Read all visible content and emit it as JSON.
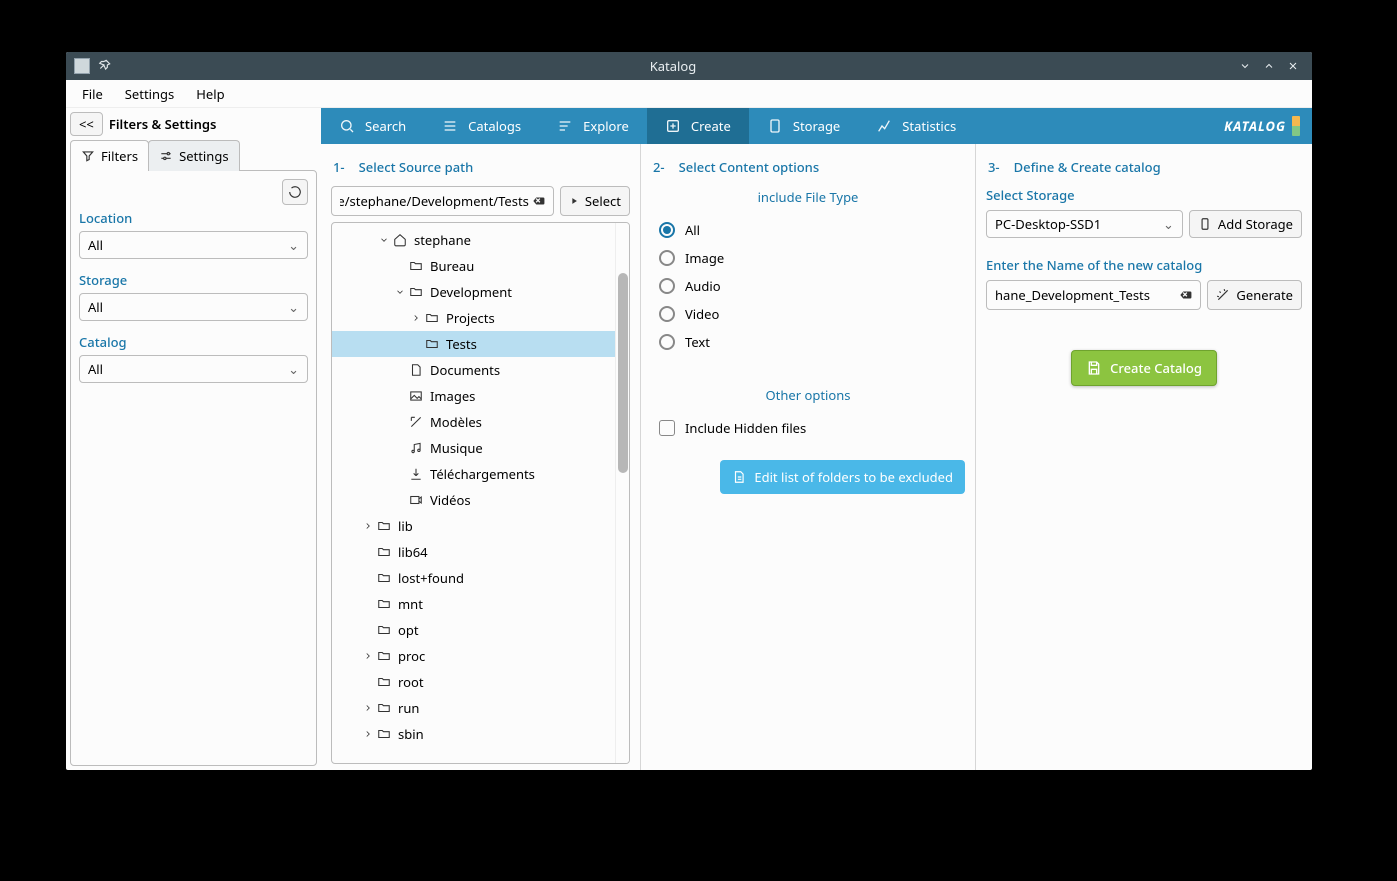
{
  "window": {
    "title": "Katalog"
  },
  "menu": {
    "file": "File",
    "settings": "Settings",
    "help": "Help"
  },
  "sidebar": {
    "collapse": "<<",
    "title": "Filters & Settings",
    "tabs": {
      "filters": "Filters",
      "settings": "Settings"
    },
    "location": {
      "label": "Location",
      "value": "All"
    },
    "storage": {
      "label": "Storage",
      "value": "All"
    },
    "catalog": {
      "label": "Catalog",
      "value": "All"
    }
  },
  "tabbar": {
    "search": "Search",
    "catalogs": "Catalogs",
    "explore": "Explore",
    "create": "Create",
    "storage": "Storage",
    "statistics": "Statistics",
    "brand": "KATALOG"
  },
  "step1": {
    "num": "1-",
    "title": "Select Source path",
    "path_value": "me/stephane/Development/Tests",
    "select_btn": "Select",
    "tree": {
      "stephane": "stephane",
      "bureau": "Bureau",
      "development": "Development",
      "projects": "Projects",
      "tests": "Tests",
      "documents": "Documents",
      "images": "Images",
      "modeles": "Modèles",
      "musique": "Musique",
      "telechargements": "Téléchargements",
      "videos": "Vidéos",
      "lib": "lib",
      "lib64": "lib64",
      "lostfound": "lost+found",
      "mnt": "mnt",
      "opt": "opt",
      "proc": "proc",
      "root": "root",
      "run": "run",
      "sbin": "sbin"
    }
  },
  "step2": {
    "num": "2-",
    "title": "Select Content options",
    "filetype_title": "include File Type",
    "options": {
      "all": "All",
      "image": "Image",
      "audio": "Audio",
      "video": "Video",
      "text": "Text"
    },
    "other_title": "Other options",
    "hidden_label": "Include Hidden files",
    "excluded_btn": "Edit list of folders to be excluded"
  },
  "step3": {
    "num": "3-",
    "title": "Define & Create catalog",
    "storage_label": "Select Storage",
    "storage_value": "PC-Desktop-SSD1",
    "add_storage_btn": "Add Storage",
    "name_label": "Enter the Name of the new catalog",
    "name_value": "hane_Development_Tests",
    "generate_btn": "Generate",
    "create_btn": "Create Catalog"
  }
}
